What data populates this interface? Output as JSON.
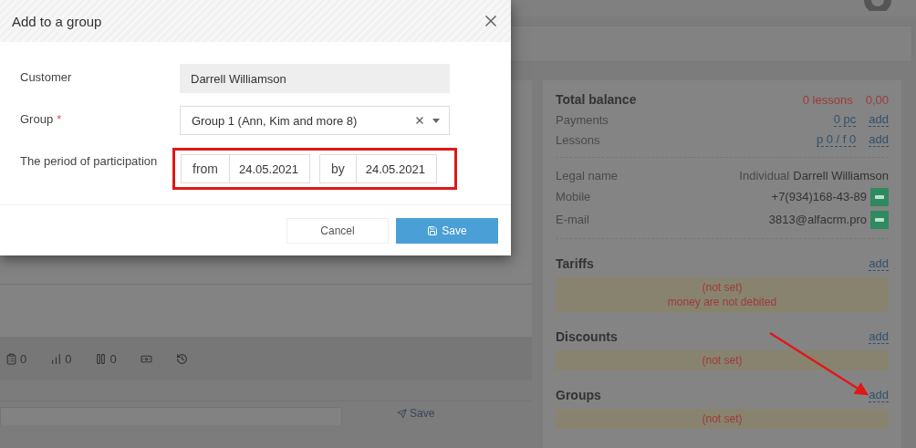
{
  "modal": {
    "title": "Add to a group",
    "fields": [
      {
        "kind": "readonly",
        "label": "Customer",
        "value": "Darrell Williamson"
      },
      {
        "kind": "select",
        "label": "Group",
        "required_mark": "*",
        "value": "Group 1 (Ann, Kim and more 8)"
      },
      {
        "kind": "period",
        "label": "The period of participation",
        "from_label": "from",
        "from_value": "24.05.2021",
        "by_label": "by",
        "by_value": "24.05.2021"
      }
    ],
    "buttons": [
      {
        "kind": "secondary",
        "label": "Cancel"
      },
      {
        "kind": "primary",
        "label": "Save"
      }
    ]
  },
  "toolbar": [
    {
      "kind": "notes",
      "count": "0"
    },
    {
      "kind": "stats",
      "count": "0"
    },
    {
      "kind": "pauses",
      "count": "0"
    },
    {
      "kind": "payments"
    },
    {
      "kind": "history"
    }
  ],
  "comment": {
    "send_label": "Save"
  },
  "summary": {
    "title": "Total balance",
    "lessons": "0 lessons",
    "amount": "0,00",
    "counters": [
      {
        "label": "Payments",
        "value": "0 pc",
        "action": "add"
      },
      {
        "label": "Lessons",
        "value": "p 0 / f 0",
        "action": "add"
      }
    ],
    "legal": {
      "label": "Legal name",
      "type": "Individual",
      "name": "Darrell Williamson"
    },
    "contacts": [
      {
        "label": "Mobile",
        "value": "+7(934)168-43-89"
      },
      {
        "label": "E-mail",
        "value": "3813@alfacrm.pro"
      }
    ],
    "sections": [
      {
        "title": "Tariffs",
        "action": "add",
        "notes": [
          "(not set)",
          "money are not debited"
        ]
      },
      {
        "title": "Discounts",
        "action": "add",
        "notes": [
          "(not set)"
        ]
      },
      {
        "title": "Groups",
        "action": "add",
        "notes": [
          "(not set)"
        ]
      }
    ]
  }
}
